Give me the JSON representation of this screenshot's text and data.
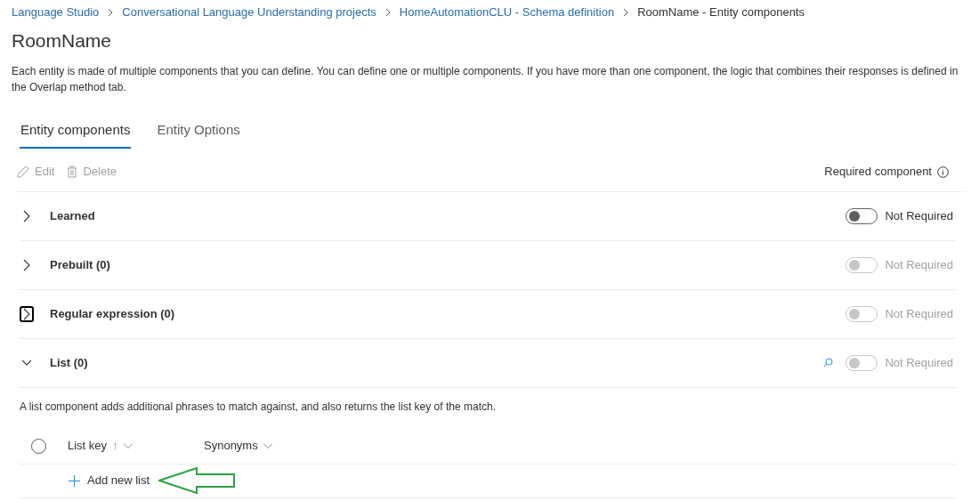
{
  "breadcrumb": [
    {
      "label": "Language Studio",
      "link": true
    },
    {
      "label": "Conversational Language Understanding projects",
      "link": true
    },
    {
      "label": "HomeAutomationCLU - Schema definition",
      "link": true
    },
    {
      "label": "RoomName - Entity components",
      "link": false
    }
  ],
  "title": "RoomName",
  "description": "Each entity is made of multiple components that you can define. You can define one or multiple components. If you have more than one component, the logic that combines their responses is defined in the Overlap method tab.",
  "tabs": [
    {
      "label": "Entity components",
      "selected": true
    },
    {
      "label": "Entity Options",
      "selected": false
    }
  ],
  "toolbar": {
    "buttons": [
      {
        "label": "Edit",
        "kind": "edit",
        "disabled": true
      },
      {
        "label": "Delete",
        "kind": "delete",
        "disabled": true
      }
    ],
    "required_header": "Required component"
  },
  "sections": [
    {
      "label": "Learned",
      "expanded": false,
      "focused": false,
      "search_icon": false,
      "toggle": {
        "on": false,
        "disabled": false,
        "label": "Not Required"
      }
    },
    {
      "label": "Prebuilt (0)",
      "expanded": false,
      "focused": false,
      "search_icon": false,
      "toggle": {
        "on": false,
        "disabled": true,
        "label": "Not Required"
      }
    },
    {
      "label": "Regular expression (0)",
      "expanded": false,
      "focused": true,
      "search_icon": false,
      "toggle": {
        "on": false,
        "disabled": true,
        "label": "Not Required"
      }
    },
    {
      "label": "List (0)",
      "expanded": true,
      "focused": false,
      "search_icon": true,
      "toggle": {
        "on": false,
        "disabled": true,
        "label": "Not Required"
      },
      "description": "A list component adds additional phrases to match against, and also returns the list key of the match.",
      "table": {
        "select_all": {
          "checked": false
        },
        "columns": [
          {
            "label": "List key",
            "sort_arrow": "↑"
          },
          {
            "label": "Synonyms"
          }
        ],
        "add_label": "Add new list"
      }
    }
  ]
}
